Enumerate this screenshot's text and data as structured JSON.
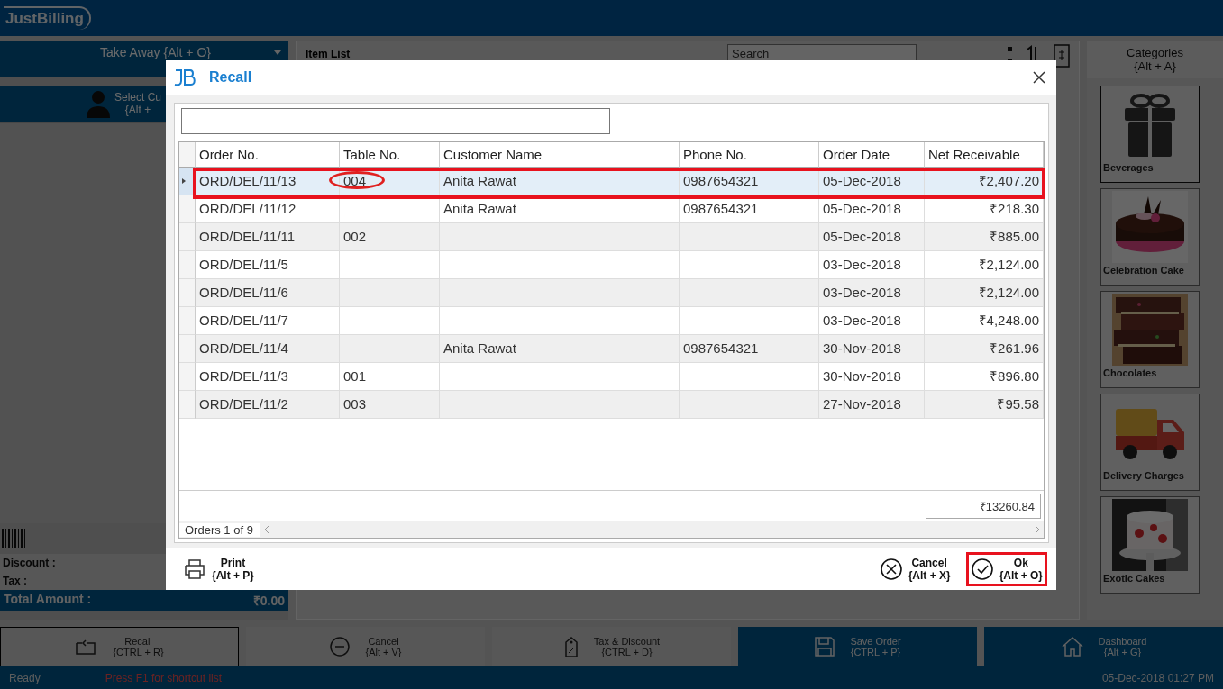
{
  "app": {
    "logo": "JustBilling"
  },
  "left_panel": {
    "order_type": "Take Away {Alt + O}",
    "customer_label": "Select Cu",
    "customer_shortcut": "{Alt +",
    "discount_label": "Discount :",
    "tax_label": "Tax :",
    "total_label": "Total Amount :",
    "total_value": "₹0.00"
  },
  "item_list": {
    "title": "Item List",
    "search_placeholder": "Search"
  },
  "categories": {
    "title": "Categories",
    "shortcut": "{Alt + A}",
    "items": [
      {
        "name": "Beverages",
        "kind": "gift",
        "selected": true
      },
      {
        "name": "Celebration Cake",
        "kind": "cake",
        "selected": false
      },
      {
        "name": "Chocolates",
        "kind": "chocolate",
        "selected": false
      },
      {
        "name": "Delivery Charges",
        "kind": "truck",
        "selected": false
      },
      {
        "name": "Exotic Cakes",
        "kind": "cake2",
        "selected": false
      }
    ]
  },
  "actions": [
    {
      "label": "Recall",
      "shortcut": "{CTRL + R}",
      "kind": "recall"
    },
    {
      "label": "Cancel",
      "shortcut": "{Alt + V}",
      "kind": "cancel"
    },
    {
      "label": "Tax & Discount",
      "shortcut": "{CTRL + D}",
      "kind": "tag"
    },
    {
      "label": "Save Order",
      "shortcut": "{CTRL + P}",
      "kind": "save"
    },
    {
      "label": "Dashboard",
      "shortcut": "{Alt + G}",
      "kind": "home"
    }
  ],
  "status_bar": {
    "state": "Ready",
    "hint": "Press F1 for shortcut list",
    "datetime": "05-Dec-2018 01:27 PM"
  },
  "dialog": {
    "title": "Recall",
    "columns": [
      "Order No.",
      "Table No.",
      "Customer Name",
      "Phone No.",
      "Order Date",
      "Net Receivable"
    ],
    "rows": [
      {
        "cells": [
          "ORD/DEL/11/13",
          "004",
          "Anita Rawat",
          "0987654321",
          "05-Dec-2018",
          "₹2,407.20"
        ],
        "selected": true,
        "marked": true,
        "circled": true
      },
      {
        "cells": [
          "ORD/DEL/11/12",
          "",
          "Anita Rawat",
          "0987654321",
          "05-Dec-2018",
          "₹218.30"
        ],
        "selected": false,
        "marked": false,
        "circled": false
      },
      {
        "cells": [
          "ORD/DEL/11/11",
          "002",
          "",
          "",
          "05-Dec-2018",
          "₹885.00"
        ],
        "selected": false,
        "marked": false,
        "circled": false
      },
      {
        "cells": [
          "ORD/DEL/11/5",
          "",
          "",
          "",
          "03-Dec-2018",
          "₹2,124.00"
        ],
        "selected": false,
        "marked": false,
        "circled": false
      },
      {
        "cells": [
          "ORD/DEL/11/6",
          "",
          "",
          "",
          "03-Dec-2018",
          "₹2,124.00"
        ],
        "selected": false,
        "marked": false,
        "circled": false
      },
      {
        "cells": [
          "ORD/DEL/11/7",
          "",
          "",
          "",
          "03-Dec-2018",
          "₹4,248.00"
        ],
        "selected": false,
        "marked": false,
        "circled": false
      },
      {
        "cells": [
          "ORD/DEL/11/4",
          "",
          "Anita Rawat",
          "0987654321",
          "30-Nov-2018",
          "₹261.96"
        ],
        "selected": false,
        "marked": false,
        "circled": false
      },
      {
        "cells": [
          "ORD/DEL/11/3",
          "001",
          "",
          "",
          "30-Nov-2018",
          "₹896.80"
        ],
        "selected": false,
        "marked": false,
        "circled": false
      },
      {
        "cells": [
          "ORD/DEL/11/2",
          "003",
          "",
          "",
          "27-Nov-2018",
          "₹95.58"
        ],
        "selected": false,
        "marked": false,
        "circled": false
      }
    ],
    "total": "₹13260.84",
    "pager": "Orders 1 of 9",
    "buttons": [
      {
        "label": "Print",
        "shortcut": "{Alt + P}",
        "kind": "print",
        "marked": false
      },
      {
        "label": "Cancel",
        "shortcut": "{Alt + X}",
        "kind": "cancel",
        "marked": false
      },
      {
        "label": "Ok",
        "shortcut": "{Alt + O}",
        "kind": "ok",
        "marked": true
      }
    ]
  }
}
